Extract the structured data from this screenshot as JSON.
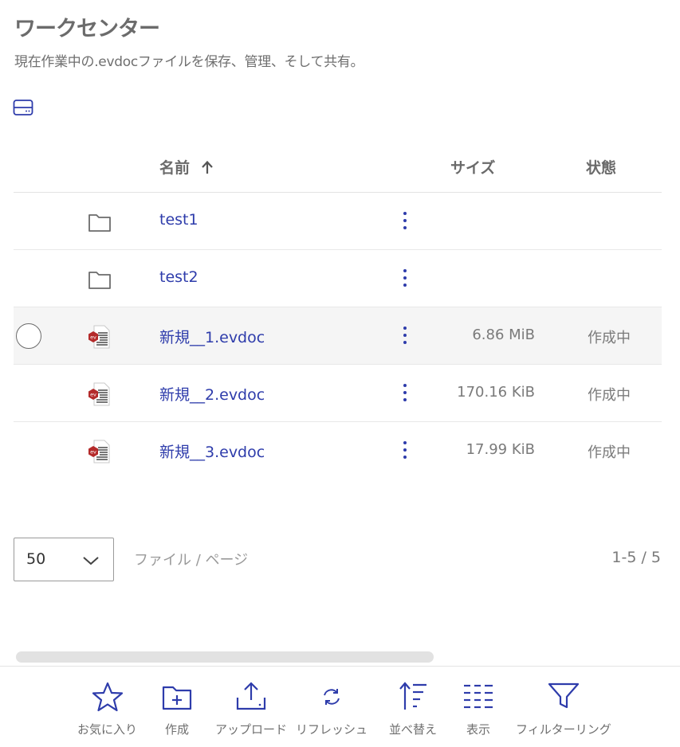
{
  "header": {
    "title": "ワークセンター",
    "subtitle": "現在作業中の.evdocファイルを保存、管理、そして共有。"
  },
  "table": {
    "columns": {
      "name": "名前",
      "size": "サイズ",
      "state": "状態"
    },
    "sort": {
      "column": "name",
      "direction": "ascending",
      "icon": "arrow-up-icon"
    },
    "rows": [
      {
        "type": "folder",
        "icon": "folder-icon",
        "name": "test1",
        "size": "",
        "state": ""
      },
      {
        "type": "folder",
        "icon": "folder-icon",
        "name": "test2",
        "size": "",
        "state": ""
      },
      {
        "type": "evdoc",
        "icon": "evdoc-file-icon",
        "name": "新規__1.evdoc",
        "size": "6.86 MiB",
        "state": "作成中",
        "hovered": true
      },
      {
        "type": "evdoc",
        "icon": "evdoc-file-icon",
        "name": "新規__2.evdoc",
        "size": "170.16 KiB",
        "state": "作成中"
      },
      {
        "type": "evdoc",
        "icon": "evdoc-file-icon",
        "name": "新規__3.evdoc",
        "size": "17.99 KiB",
        "state": "作成中"
      }
    ]
  },
  "pagination": {
    "per_page_value": "50",
    "per_page_label": "ファイル / ページ",
    "range": "1-5 / 5"
  },
  "toolbar": {
    "items": [
      {
        "label": "お気に入り",
        "icon": "star-icon"
      },
      {
        "label": "作成",
        "icon": "folder-plus-icon"
      },
      {
        "label": "アップロード",
        "icon": "upload-icon"
      },
      {
        "label": "リフレッシュ",
        "icon": "refresh-icon"
      },
      {
        "label": "並べ替え",
        "icon": "sort-icon"
      },
      {
        "label": "表示",
        "icon": "list-view-icon"
      },
      {
        "label": "フィルターリング",
        "icon": "filter-icon"
      }
    ]
  },
  "colors": {
    "accent": "#2e3cab",
    "evdoc_badge": "#b42a2a",
    "muted_text": "#7a7a7a"
  }
}
